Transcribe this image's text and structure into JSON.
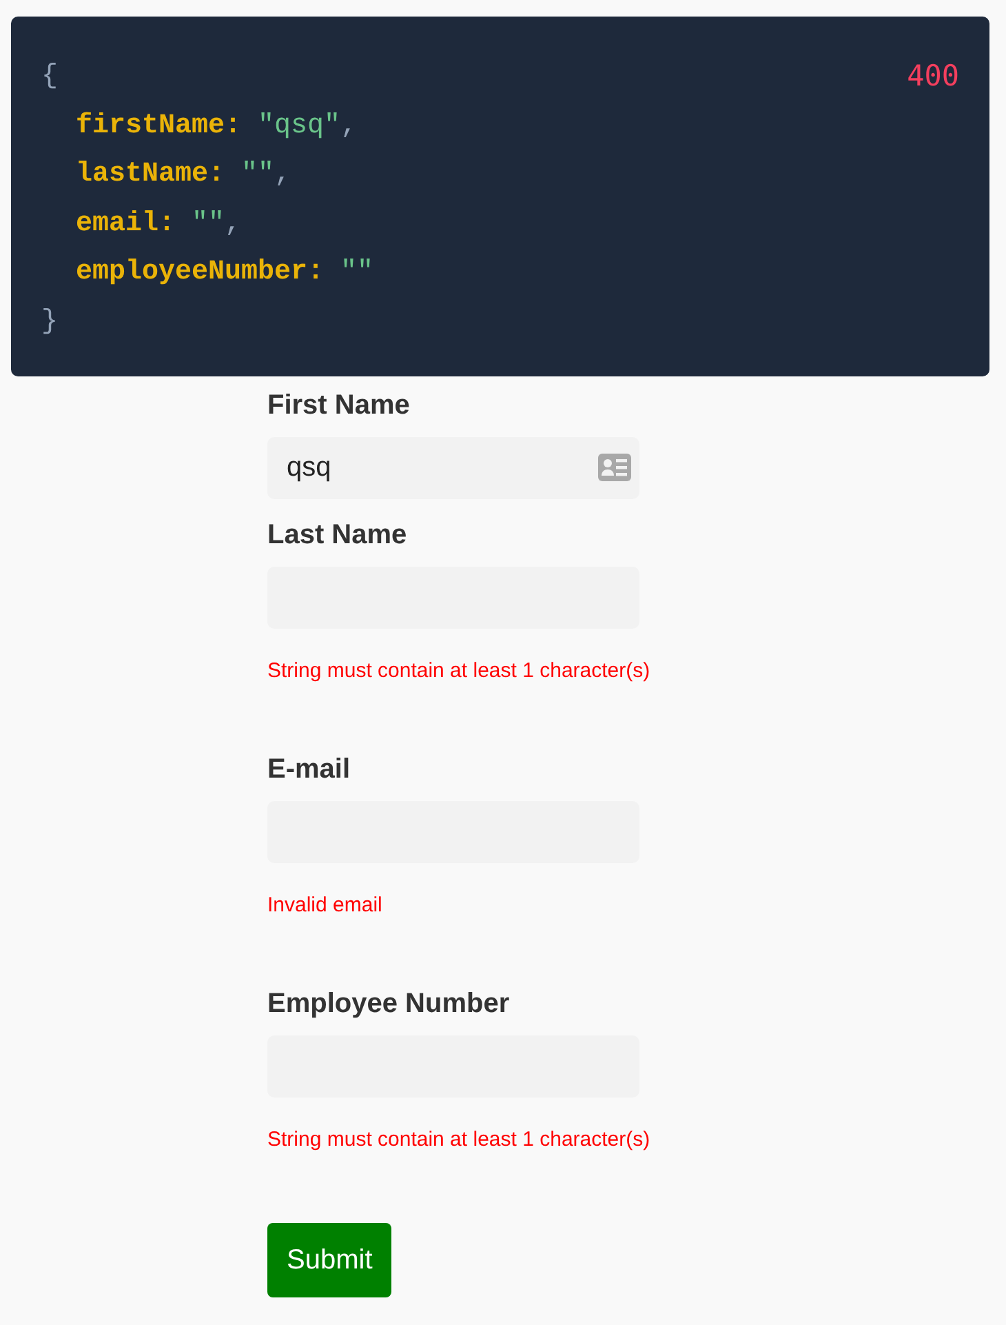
{
  "response": {
    "status": "400",
    "open": "{",
    "close": "}",
    "fields": [
      {
        "key": "firstName:",
        "value": "\"qsq\"",
        "comma": ","
      },
      {
        "key": "lastName:",
        "value": "\"\"",
        "comma": ","
      },
      {
        "key": "email:",
        "value": "\"\"",
        "comma": ","
      },
      {
        "key": "employeeNumber:",
        "value": "\"\""
      }
    ]
  },
  "form": {
    "fields": [
      {
        "label": "First Name",
        "value": "qsq",
        "autofill_icon": true
      },
      {
        "label": "Last Name",
        "error": "String must contain at least 1 character(s)"
      },
      {
        "label": "E-mail",
        "error": "Invalid email"
      },
      {
        "label": "Employee Number",
        "error": "String must contain at least 1 character(s)"
      }
    ],
    "submit": "Submit"
  }
}
